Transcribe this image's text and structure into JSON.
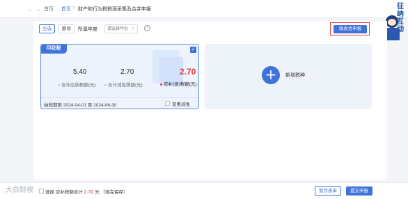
{
  "header": {
    "back_glyph": "←",
    "forward_glyph": "→",
    "home_label": "首页",
    "breadcrumb_link": "首页",
    "breadcrumb_sep": ">",
    "breadcrumb_current": "财产和行为税税源采集及合并申报"
  },
  "mascot": {
    "side_text": "征纳互动"
  },
  "toolbar": {
    "all_label": "全选",
    "delete_label": "删除",
    "filter_label": "所属年度",
    "search_placeholder": "请选择年份",
    "search_glyph": "⌕",
    "info_glyph": "!",
    "primary_label": "填表式申报"
  },
  "tax_card": {
    "tag": "印花税",
    "check_glyph": "✓",
    "amount_calc": "5.40",
    "amount_calc_label": "合计应纳税额(元)",
    "amount_relief": "2.70",
    "amount_relief_label": "合计减免税额(元)",
    "amount_due": "2.70",
    "amount_due_label": "应补(退)税额(元)",
    "period": "纳税期限 2024-04-01 至 2024-06-30",
    "preference_label": "普惠减免"
  },
  "add_card": {
    "plus_glyph": "+",
    "label": "新增税种"
  },
  "bottom": {
    "select_label": "选择",
    "summary_mid": "应补税额合计",
    "total": "2.70",
    "summary_tail": "元 （填完保存）",
    "save_label": "暂存表单",
    "submit_label": "提交申报"
  },
  "watermark": "大白财税",
  "colors": {
    "accent": "#3f73d9",
    "highlight_red": "#e23b3b",
    "card_bg": "#eef4fd"
  }
}
